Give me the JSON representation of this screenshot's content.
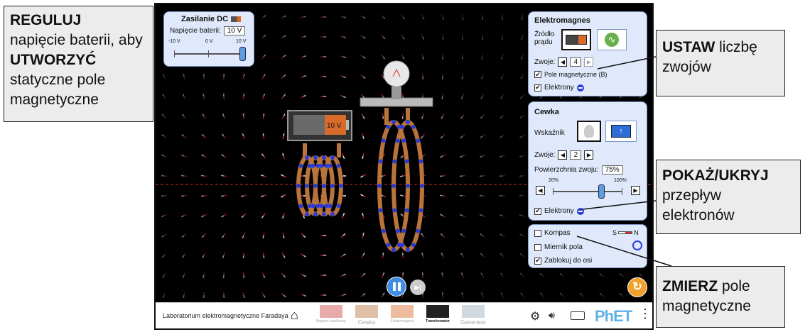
{
  "callouts": {
    "reguluj": {
      "bold1": "REGULUJ",
      "text1": "napięcie baterii, aby",
      "bold2": "UTWORZYĆ",
      "text2": "statyczne pole magnetyczne"
    },
    "ustaw": {
      "bold": "USTAW",
      "text": "liczbę zwojów"
    },
    "pokaz": {
      "bold": "POKAŻ/UKRYJ",
      "text": "przepływ elektronów"
    },
    "zmierz": {
      "bold": "ZMIERZ",
      "text": "pole magnetyczne"
    }
  },
  "dc_panel": {
    "title": "Zasilanie DC",
    "voltage_label": "Napięcie baterii:",
    "voltage_value": "10 V",
    "tick_min": "-10 V",
    "tick_mid": "0 V",
    "tick_max": "10 V",
    "voltage_fraction": 1.0
  },
  "battery_label": "10 V",
  "electromagnet_panel": {
    "title": "Elektromagnes",
    "source_label": "Źródło prądu",
    "turns_label": "Zwoje:",
    "turns_value": "4",
    "magnetic_field_label": "Pole magnetyczne (B)",
    "electrons_label": "Elektrony",
    "magnetic_field_checked": true,
    "electrons_checked": true
  },
  "coil_panel": {
    "title": "Cewka",
    "indicator_label": "Wskaźnik",
    "turns_label": "Zwoje:",
    "turns_value": "2",
    "area_label": "Powierzchnia zwoju:",
    "area_value": "75%",
    "tick_min": "20%",
    "tick_max": "100%",
    "area_fraction": 0.69,
    "electrons_label": "Elektrony",
    "electrons_checked": true
  },
  "tools_panel": {
    "compass_label": "Kompas",
    "compass_s": "S",
    "compass_n": "N",
    "field_meter_label": "Miernik pola",
    "lock_label": "Zablokuj do osi",
    "compass_checked": false,
    "field_meter_checked": false,
    "lock_checked": true
  },
  "bottombar": {
    "sim_title": "Laboratorium elektromagnetyczne Faradaya",
    "screens": [
      {
        "label": "Magnes sztabkowy"
      },
      {
        "label": "Cewka"
      },
      {
        "label": "Elektromagnes"
      },
      {
        "label": "Transformator"
      },
      {
        "label": "Generator"
      }
    ],
    "brand": "PhET"
  },
  "colors": {
    "panel_bg": "#dfe9fb",
    "panel_border": "#7f96c4",
    "coil": "#b8743a",
    "electron": "#2a3bd8",
    "reset": "#f2a22c",
    "play": "#3f8ee6"
  }
}
